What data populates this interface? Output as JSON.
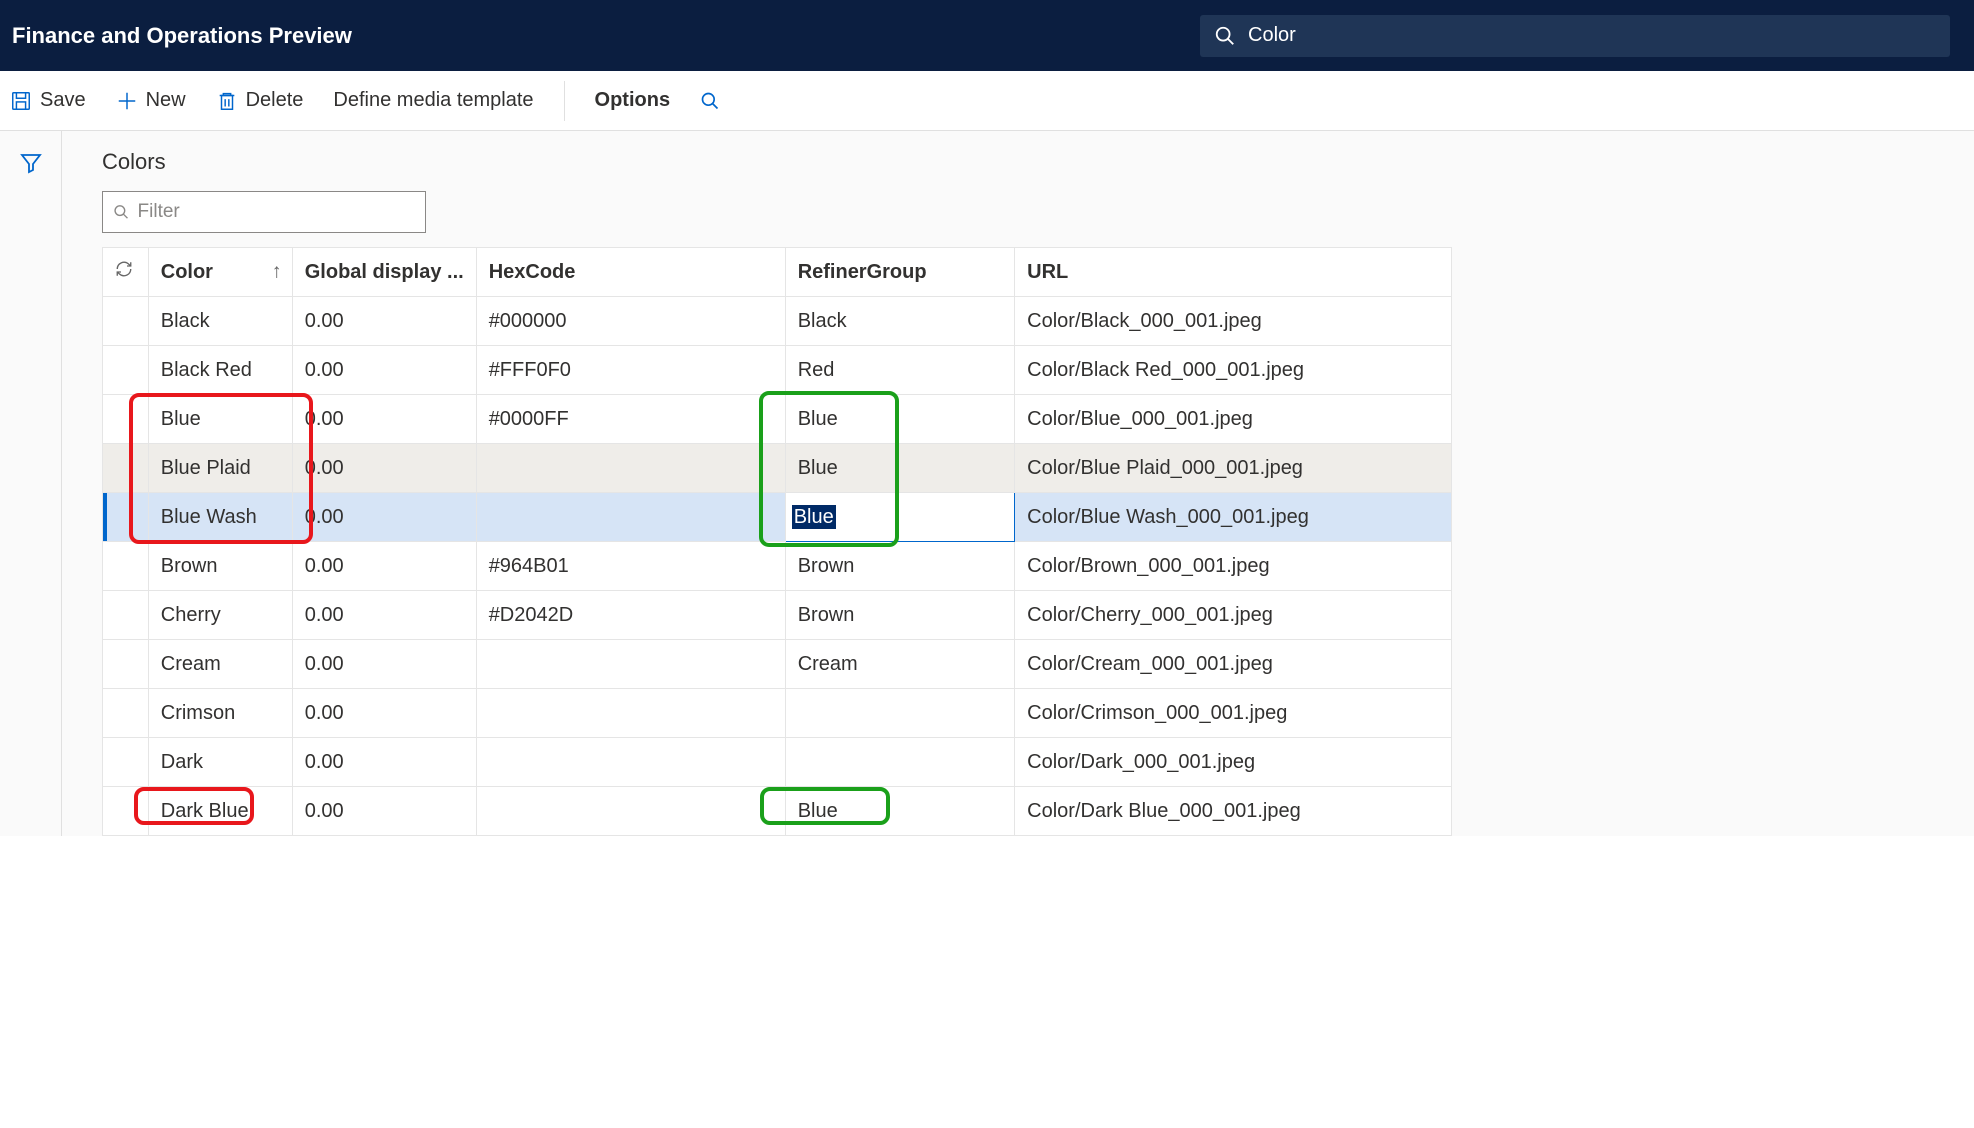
{
  "header": {
    "app_title": "Finance and Operations Preview",
    "search_value": "Color"
  },
  "command_bar": {
    "save": "Save",
    "new": "New",
    "delete": "Delete",
    "define_media_template": "Define media template",
    "options": "Options"
  },
  "page": {
    "title": "Colors",
    "filter_placeholder": "Filter",
    "columns": {
      "color": "Color",
      "global_display": "Global display ...",
      "hexcode": "HexCode",
      "refiner_group": "RefinerGroup",
      "url": "URL"
    },
    "rows": [
      {
        "color": "Black",
        "gdo": "0.00",
        "hex": "#000000",
        "refiner": "Black",
        "url": "Color/Black_000_001.jpeg",
        "state": ""
      },
      {
        "color": "Black Red",
        "gdo": "0.00",
        "hex": "#FFF0F0",
        "refiner": "Red",
        "url": "Color/Black Red_000_001.jpeg",
        "state": ""
      },
      {
        "color": "Blue",
        "gdo": "0.00",
        "hex": "#0000FF",
        "refiner": "Blue",
        "url": "Color/Blue_000_001.jpeg",
        "state": ""
      },
      {
        "color": "Blue Plaid",
        "gdo": "0.00",
        "hex": "",
        "refiner": "Blue",
        "url": "Color/Blue Plaid_000_001.jpeg",
        "state": "alt"
      },
      {
        "color": "Blue Wash",
        "gdo": "0.00",
        "hex": "",
        "refiner": "Blue",
        "url": "Color/Blue Wash_000_001.jpeg",
        "state": "sel",
        "editing": true
      },
      {
        "color": "Brown",
        "gdo": "0.00",
        "hex": "#964B01",
        "refiner": "Brown",
        "url": "Color/Brown_000_001.jpeg",
        "state": ""
      },
      {
        "color": "Cherry",
        "gdo": "0.00",
        "hex": "#D2042D",
        "refiner": "Brown",
        "url": "Color/Cherry_000_001.jpeg",
        "state": ""
      },
      {
        "color": "Cream",
        "gdo": "0.00",
        "hex": "",
        "refiner": "Cream",
        "url": "Color/Cream_000_001.jpeg",
        "state": ""
      },
      {
        "color": "Crimson",
        "gdo": "0.00",
        "hex": "",
        "refiner": "",
        "url": "Color/Crimson_000_001.jpeg",
        "state": ""
      },
      {
        "color": "Dark",
        "gdo": "0.00",
        "hex": "",
        "refiner": "",
        "url": "Color/Dark_000_001.jpeg",
        "state": ""
      },
      {
        "color": "Dark Blue",
        "gdo": "0.00",
        "hex": "",
        "refiner": "Blue",
        "url": "Color/Dark Blue_000_001.jpeg",
        "state": ""
      }
    ]
  }
}
